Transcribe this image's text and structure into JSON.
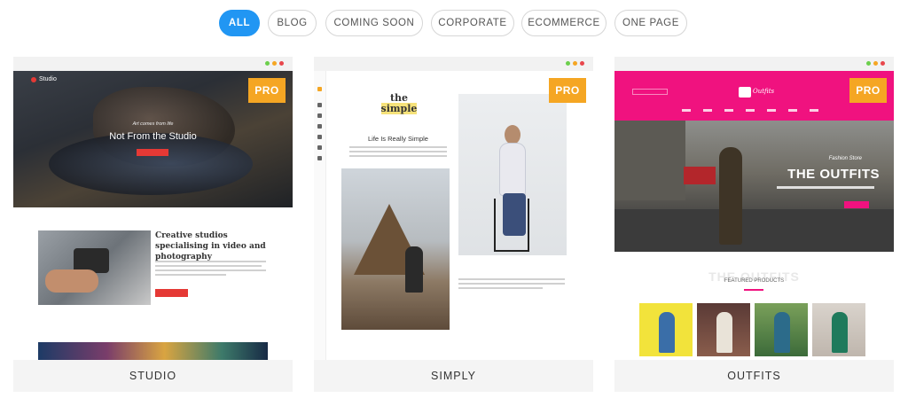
{
  "filters": [
    {
      "label": "ALL",
      "active": true
    },
    {
      "label": "BLOG",
      "active": false
    },
    {
      "label": "COMING SOON",
      "active": false
    },
    {
      "label": "CORPORATE",
      "active": false
    },
    {
      "label": "ECOMMERCE",
      "active": false
    },
    {
      "label": "ONE PAGE",
      "active": false
    }
  ],
  "colors": {
    "accent": "#2196f3",
    "pro_badge": "#f5a623",
    "dot_green": "#6ccf4c",
    "dot_orange": "#f5a623",
    "dot_red": "#e8474c",
    "outfits_pink": "#f0127f",
    "studio_red": "#e53935"
  },
  "cards": [
    {
      "name": "STUDIO",
      "badge": "PRO",
      "preview": {
        "logo": "Studio",
        "tagline": "Art comes from life",
        "hero_title": "Not From the Studio",
        "section_heading": "Creative studios specialising in video and photography"
      }
    },
    {
      "name": "SIMPLY",
      "badge": "PRO",
      "preview": {
        "logo_line1": "the",
        "logo_line2": "simple",
        "heading": "Life Is Really Simple"
      }
    },
    {
      "name": "OUTFITS",
      "badge": "PRO",
      "preview": {
        "logo": "Outfits",
        "hero_subtitle": "Fashion Store",
        "hero_title": "THE OUTFITS",
        "section_faded": "THE OUTFITS",
        "section_title": "FEATURED PRODUCTS"
      }
    }
  ]
}
